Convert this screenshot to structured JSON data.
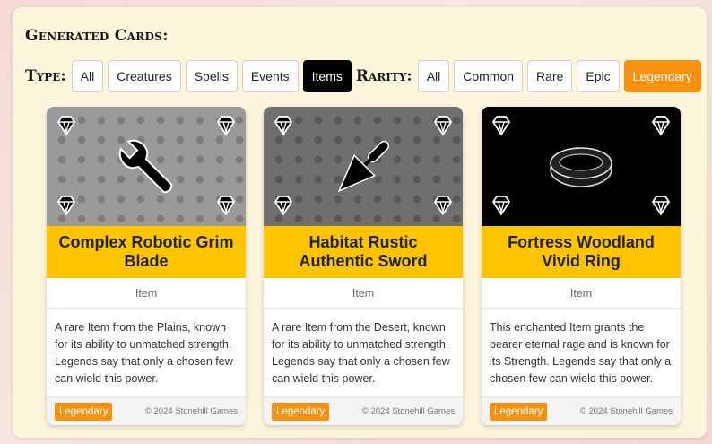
{
  "section": {
    "heading": "Generated Cards:"
  },
  "filters": {
    "type_label": "Type:",
    "type_options": [
      "All",
      "Creatures",
      "Spells",
      "Events",
      "Items"
    ],
    "type_selected": "Items",
    "rarity_label": "Rarity:",
    "rarity_options": [
      "All",
      "Common",
      "Rare",
      "Epic",
      "Legendary"
    ],
    "rarity_selected": "Legendary"
  },
  "colors": {
    "title_band": "#ffc400",
    "accent_orange": "#f7910f",
    "panel_bg": "#fdf5dc"
  },
  "cards": [
    {
      "title": "Complex Robotic Grim Blade",
      "type": "Item",
      "description": "A rare Item from the Plains, known for its ability to unmatched strength. Legends say that only a chosen few can wield this power.",
      "rarity": "Legendary",
      "copyright": "© 2024 Stonehill Games",
      "art_icon": "wrench-icon",
      "corner_icon": "gem-icon"
    },
    {
      "title": "Habitat Rustic Authentic Sword",
      "type": "Item",
      "description": "A rare Item from the Desert, known for its ability to unmatched strength. Legends say that only a chosen few can wield this power.",
      "rarity": "Legendary",
      "copyright": "© 2024 Stonehill Games",
      "art_icon": "trowel-icon",
      "corner_icon": "gem-icon"
    },
    {
      "title": "Fortress Woodland Vivid Ring",
      "type": "Item",
      "description": "This enchanted Item grants the bearer eternal rage and is known for its Strength. Legends say that only a chosen few can wield this power.",
      "rarity": "Legendary",
      "copyright": "© 2024 Stonehill Games",
      "art_icon": "ring-icon",
      "corner_icon": "gem-icon"
    }
  ]
}
